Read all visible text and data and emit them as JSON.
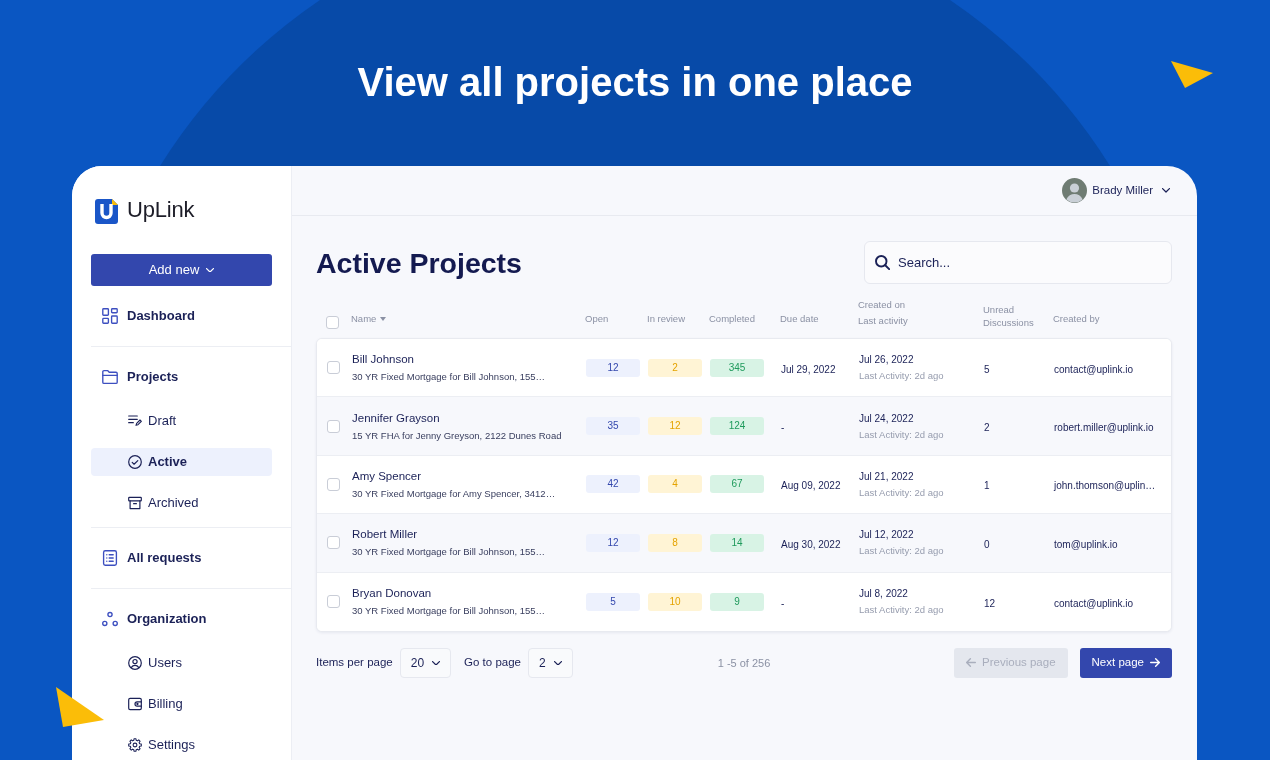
{
  "hero": {
    "title": "View all projects in one place"
  },
  "sidebar": {
    "logo": "UpLink",
    "add_button": "Add new",
    "nav": [
      {
        "label": "Dashboard",
        "selected": false
      },
      {
        "label": "Projects",
        "selected": false,
        "children": [
          {
            "label": "Draft",
            "selected": false
          },
          {
            "label": "Active",
            "selected": true
          },
          {
            "label": "Archived",
            "selected": false
          }
        ]
      },
      {
        "label": "All requests",
        "selected": false
      },
      {
        "label": "Organization",
        "selected": false,
        "children": [
          {
            "label": "Users",
            "selected": false
          },
          {
            "label": "Billing",
            "selected": false
          },
          {
            "label": "Settings",
            "selected": false
          }
        ]
      }
    ]
  },
  "header": {
    "user": {
      "name": "Brady Miller"
    }
  },
  "page": {
    "title": "Active Projects",
    "search": {
      "placeholder": "Search..."
    }
  },
  "table": {
    "select_all": {
      "checked": false
    },
    "columns": [
      {
        "label": "Name",
        "sorted": true
      },
      {
        "label": "Open",
        "sorted": false
      },
      {
        "label": "In review",
        "sorted": false
      },
      {
        "label": "Completed",
        "sorted": false
      },
      {
        "label": "Due date",
        "sorted": false
      },
      {
        "label": "Created on",
        "sublabel": "Last activity",
        "sorted": false
      },
      {
        "label": "Unread Discussions",
        "sorted": false
      },
      {
        "label": "Created by",
        "sorted": false
      }
    ],
    "rows": [
      {
        "checked": false,
        "name": "Bill Johnson",
        "description": "30 YR Fixed Mortgage for Bill Johnson, 155…",
        "open": "12",
        "in_review": "2",
        "completed": "345",
        "due_date": "Jul 29, 2022",
        "created_on": "Jul 26, 2022",
        "last_activity": "Last Activity: 2d ago",
        "unread": "5",
        "created_by": "contact@uplink.io"
      },
      {
        "checked": false,
        "name": "Jennifer Grayson",
        "description": "15 YR FHA for Jenny Greyson, 2122 Dunes Road",
        "open": "35",
        "in_review": "12",
        "completed": "124",
        "due_date": "-",
        "created_on": "Jul 24, 2022",
        "last_activity": "Last Activity: 2d ago",
        "unread": "2",
        "created_by": "robert.miller@uplink.io"
      },
      {
        "checked": false,
        "name": "Amy Spencer",
        "description": "30 YR Fixed Mortgage for Amy Spencer, 3412…",
        "open": "42",
        "in_review": "4",
        "completed": "67",
        "due_date": "Aug 09, 2022",
        "created_on": "Jul 21, 2022",
        "last_activity": "Last Activity: 2d ago",
        "unread": "1",
        "created_by": "john.thomson@uplin…"
      },
      {
        "checked": false,
        "name": "Robert Miller",
        "description": "30 YR Fixed Mortgage for Bill Johnson, 155…",
        "open": "12",
        "in_review": "8",
        "completed": "14",
        "due_date": "Aug 30, 2022",
        "created_on": "Jul 12, 2022",
        "last_activity": "Last Activity: 2d ago",
        "unread": "0",
        "created_by": "tom@uplink.io"
      },
      {
        "checked": false,
        "name": "Bryan Donovan",
        "description": "30 YR Fixed Mortgage for Bill Johnson, 155…",
        "open": "5",
        "in_review": "10",
        "completed": "9",
        "due_date": "-",
        "created_on": "Jul 8, 2022",
        "last_activity": "Last Activity: 2d ago",
        "unread": "12",
        "created_by": "contact@uplink.io"
      }
    ]
  },
  "pagination": {
    "items_per_page_label": "Items per page",
    "items_per_page": "20",
    "go_to_page_label": "Go to page",
    "page": "2",
    "range": "1 -5 of 256",
    "previous": {
      "label": "Previous page",
      "disabled": true
    },
    "next": {
      "label": "Next page",
      "disabled": false
    }
  }
}
